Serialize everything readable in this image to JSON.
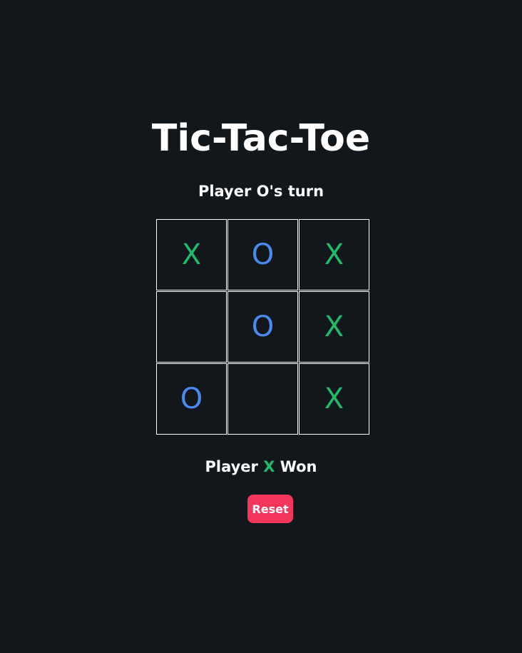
{
  "game": {
    "title": "Tic-Tac-Toe",
    "turn_text": "Player O's turn",
    "board": [
      {
        "mark": "X"
      },
      {
        "mark": "O"
      },
      {
        "mark": "X"
      },
      {
        "mark": ""
      },
      {
        "mark": "O"
      },
      {
        "mark": "X"
      },
      {
        "mark": "O"
      },
      {
        "mark": ""
      },
      {
        "mark": "X"
      }
    ],
    "result": {
      "prefix": "Player",
      "winner": "X",
      "suffix": "Won"
    },
    "reset_label": "Reset"
  },
  "colors": {
    "background": "#12171c",
    "x_color": "#1fba6a",
    "o_color": "#4b8af0",
    "reset_button": "#f5365c"
  }
}
